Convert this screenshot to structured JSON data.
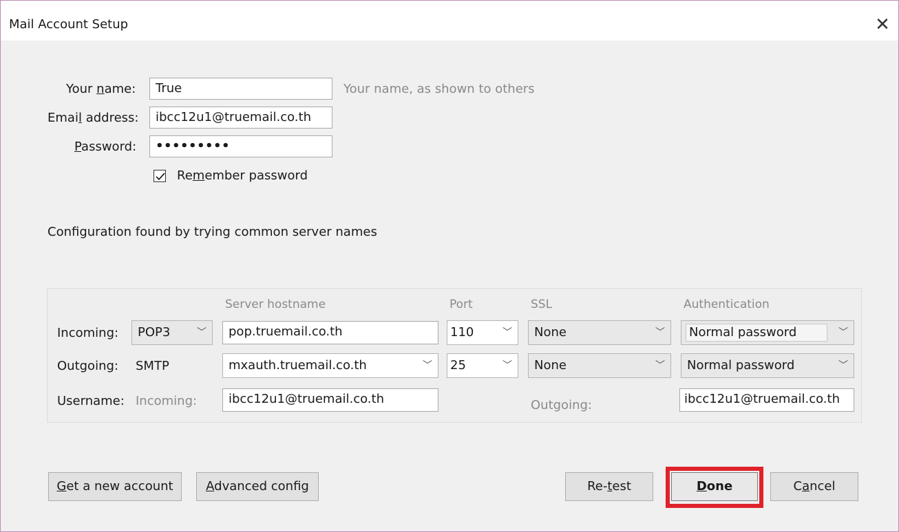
{
  "window": {
    "title": "Mail Account Setup",
    "close_glyph": "✕"
  },
  "account": {
    "name_label_pre": "Your ",
    "name_label_key": "n",
    "name_label_post": "ame:",
    "name_value": "True",
    "name_hint": "Your name, as shown to others",
    "email_label_pre": "Emai",
    "email_label_key": "l",
    "email_label_post": " address:",
    "email_value": "ibcc12u1@truemail.co.th",
    "password_label_key": "P",
    "password_label_post": "assword:",
    "password_value": "•••••••••",
    "remember_label_pre": "Re",
    "remember_label_key": "m",
    "remember_label_post": "ember password",
    "remember_checked": true
  },
  "status_message": "Configuration found by trying common server names",
  "server": {
    "col_hostname": "Server hostname",
    "col_port": "Port",
    "col_ssl": "SSL",
    "col_auth": "Authentication",
    "incoming_label": "Incoming:",
    "incoming_protocol": "POP3",
    "incoming_hostname": "pop.truemail.co.th",
    "incoming_port": "110",
    "incoming_ssl": "None",
    "incoming_auth": "Normal password",
    "outgoing_label": "Outgoing:",
    "outgoing_protocol": "SMTP",
    "outgoing_hostname": "mxauth.truemail.co.th",
    "outgoing_port": "25",
    "outgoing_ssl": "None",
    "outgoing_auth": "Normal password",
    "username_label": "Username:",
    "username_incoming_label": "Incoming:",
    "username_incoming_value": "ibcc12u1@truemail.co.th",
    "username_outgoing_label": "Outgoing:",
    "username_outgoing_value": "ibcc12u1@truemail.co.th"
  },
  "buttons": {
    "new_account_key": "G",
    "new_account_rest": "et a new account",
    "advanced_key": "A",
    "advanced_rest": "dvanced config",
    "retest_pre": "Re-",
    "retest_key": "t",
    "retest_post": "est",
    "done_key": "D",
    "done_rest": "one",
    "cancel_pre": "C",
    "cancel_key": "a",
    "cancel_post": "ncel"
  },
  "colors": {
    "highlight": "#e0232b",
    "window_border": "#b98ab5"
  },
  "icons": {
    "chevron": "chevron-down-icon",
    "check": "checkmark-icon",
    "close": "close-icon"
  }
}
